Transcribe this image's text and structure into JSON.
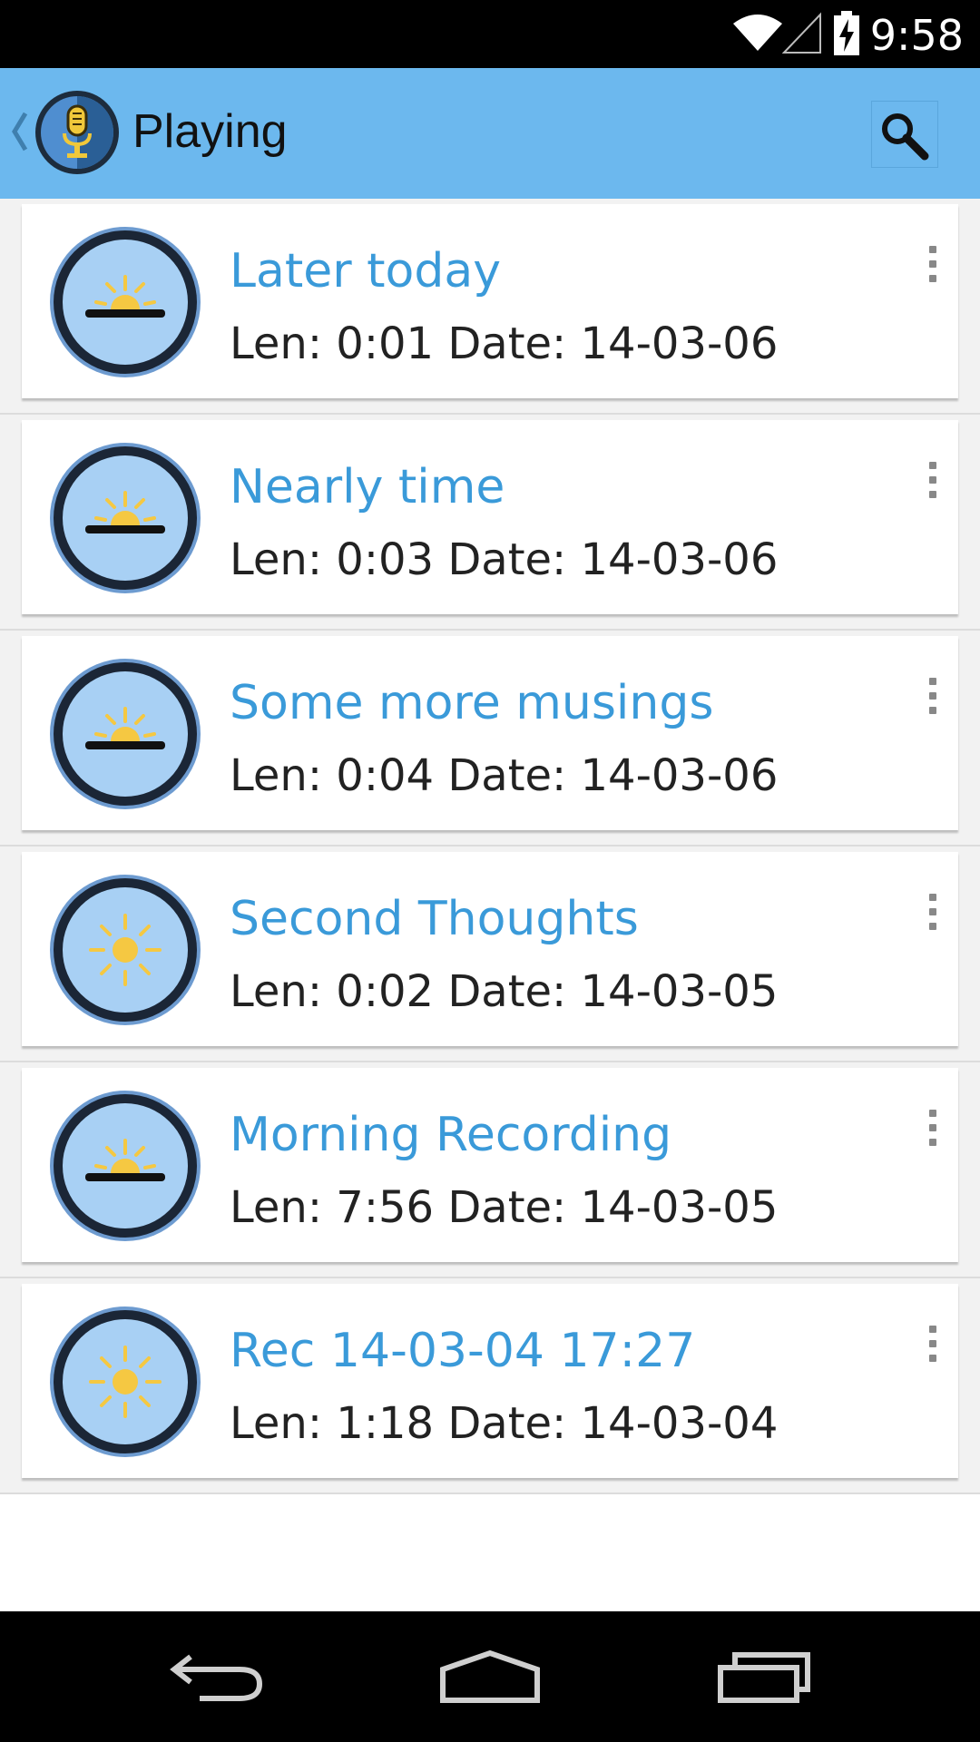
{
  "status_bar": {
    "time": "9:58",
    "icons": [
      "wifi-icon",
      "cell-signal-icon",
      "battery-charging-icon"
    ]
  },
  "action_bar": {
    "title": "Playing",
    "logo_icon": "microphone-icon",
    "action_icon": "search-icon",
    "background": "#6cb8ee"
  },
  "recordings": [
    {
      "title": "Later today",
      "meta": "Len: 0:01 Date: 14-03-06",
      "icon": "sunrise-icon"
    },
    {
      "title": "Nearly time",
      "meta": "Len: 0:03 Date: 14-03-06",
      "icon": "sunrise-icon"
    },
    {
      "title": "Some more musings",
      "meta": "Len: 0:04 Date: 14-03-06",
      "icon": "sunrise-icon"
    },
    {
      "title": "Second Thoughts",
      "meta": "Len: 0:02 Date: 14-03-05",
      "icon": "sun-icon"
    },
    {
      "title": "Morning Recording",
      "meta": "Len: 7:56 Date: 14-03-05",
      "icon": "sunrise-icon"
    },
    {
      "title": "Rec 14-03-04 17:27",
      "meta": "Len: 1:18 Date: 14-03-04",
      "icon": "sun-icon"
    }
  ],
  "colors": {
    "title_text": "#3a9ad9",
    "avatar_fill": "#a8d0f4",
    "avatar_ring": "#1c2a3a",
    "sun": "#f5c842"
  },
  "nav_bar": {
    "icons": [
      "back-icon",
      "home-icon",
      "recent-apps-icon"
    ]
  }
}
